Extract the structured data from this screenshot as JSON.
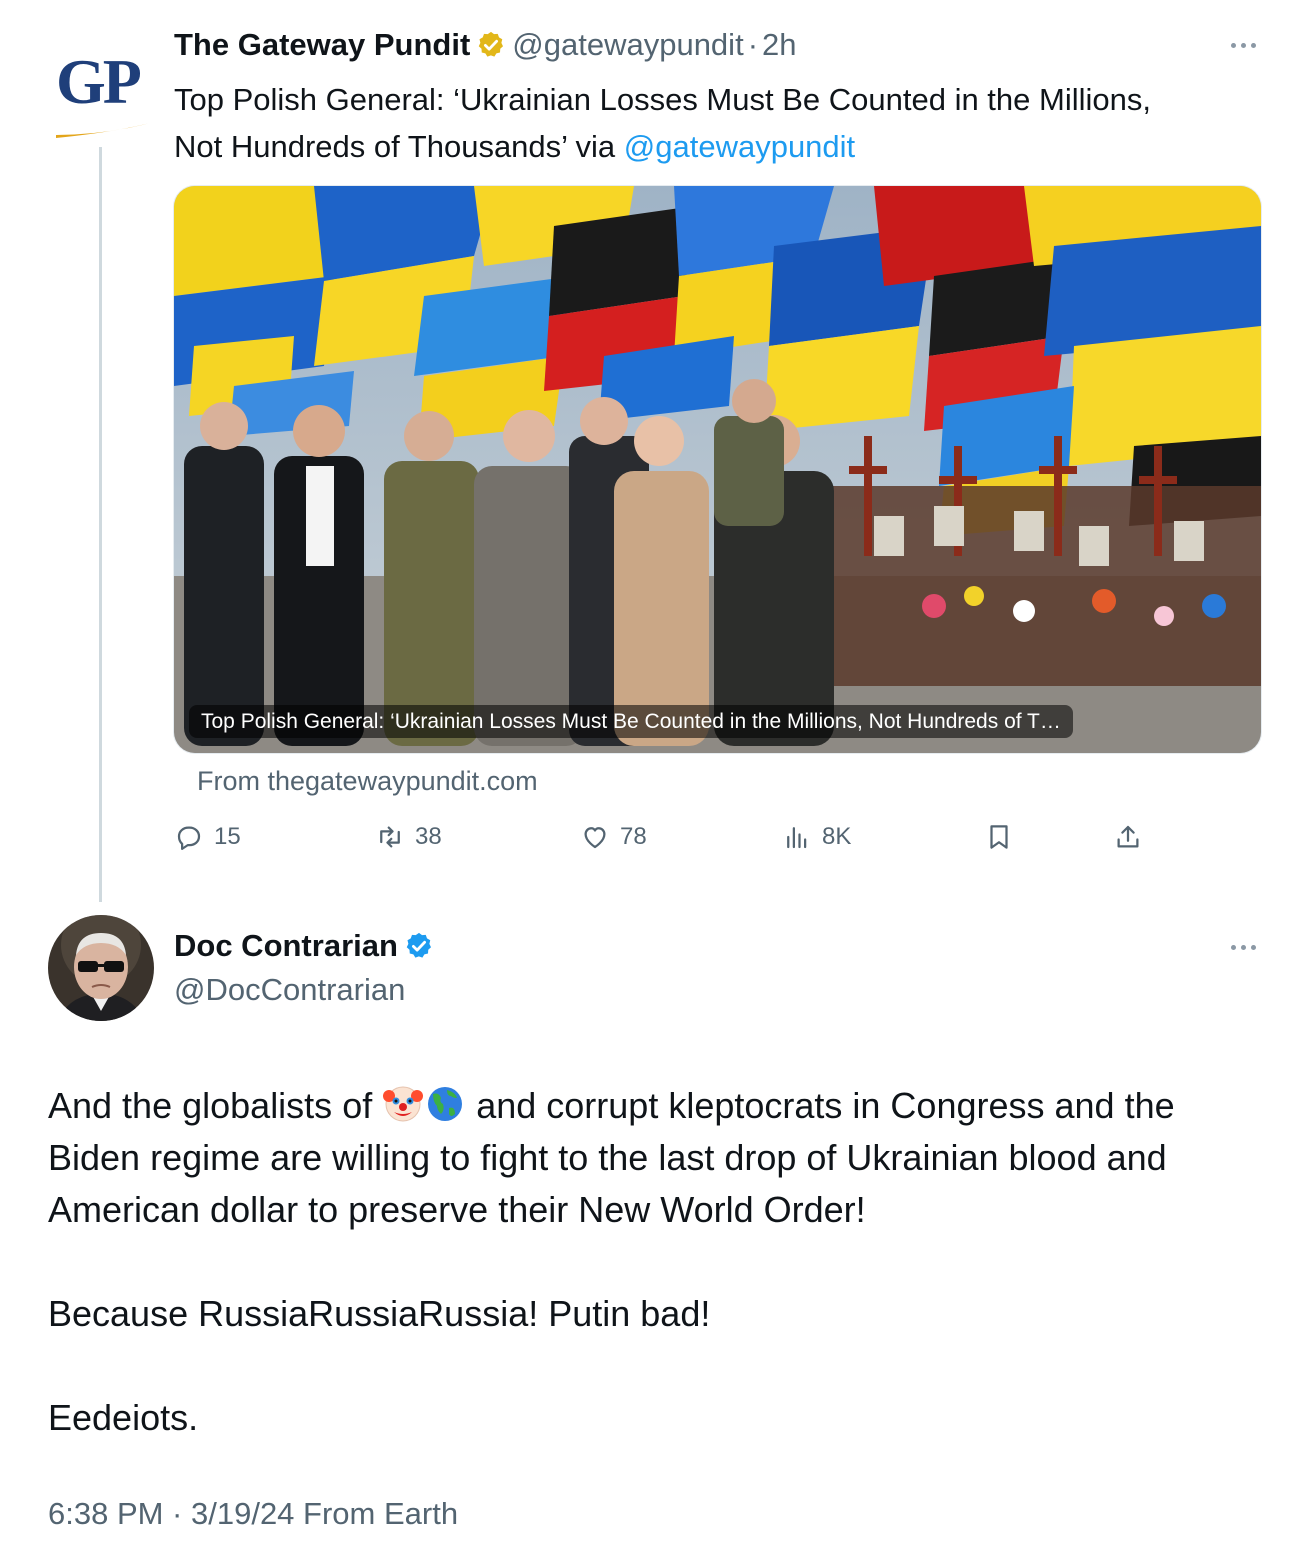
{
  "quoted_tweet": {
    "author_name": "The Gateway Pundit",
    "avatar_letters": "GP",
    "handle": "@gatewaypundit",
    "separator": "·",
    "time_ago": "2h",
    "text_line1": "Top Polish General: ‘Ukrainian Losses Must Be Counted in the Millions,",
    "text_line2_prefix": "Not Hundreds of Thousands’ via ",
    "text_mention": "@gatewaypundit",
    "card": {
      "caption": "Top Polish General: ‘Ukrainian Losses Must Be Counted in the Millions, Not Hundreds of T…",
      "source": "From thegatewaypundit.com"
    },
    "actions": {
      "replies": "15",
      "retweets": "38",
      "likes": "78",
      "views": "8K"
    },
    "verified_badge_color": "#e2b719"
  },
  "main_tweet": {
    "author_name": "Doc Contrarian",
    "handle": "@DocContrarian",
    "verified_badge_color": "#1d9bf0",
    "paragraph1_before_emoji": "And the globalists of ",
    "emoji_icons": [
      "clown-face-icon",
      "globe-americas-icon"
    ],
    "paragraph1_after_emoji": " and corrupt kleptocrats in Congress and the Biden regime are willing to fight to the last drop of Ukrainian blood and American dollar to preserve their New World Order!",
    "paragraph2": "Because RussiaRussiaRussia! Putin bad!",
    "paragraph3": "Eedeiots.",
    "footer": "6:38 PM · 3/19/24 From Earth"
  },
  "colors": {
    "text_primary": "#0f1419",
    "text_secondary": "#536471",
    "link": "#1d9bf0",
    "thread_line": "#cfd9de",
    "gp_blue": "#1f3f7a",
    "gp_gold": "#e3a51a"
  }
}
